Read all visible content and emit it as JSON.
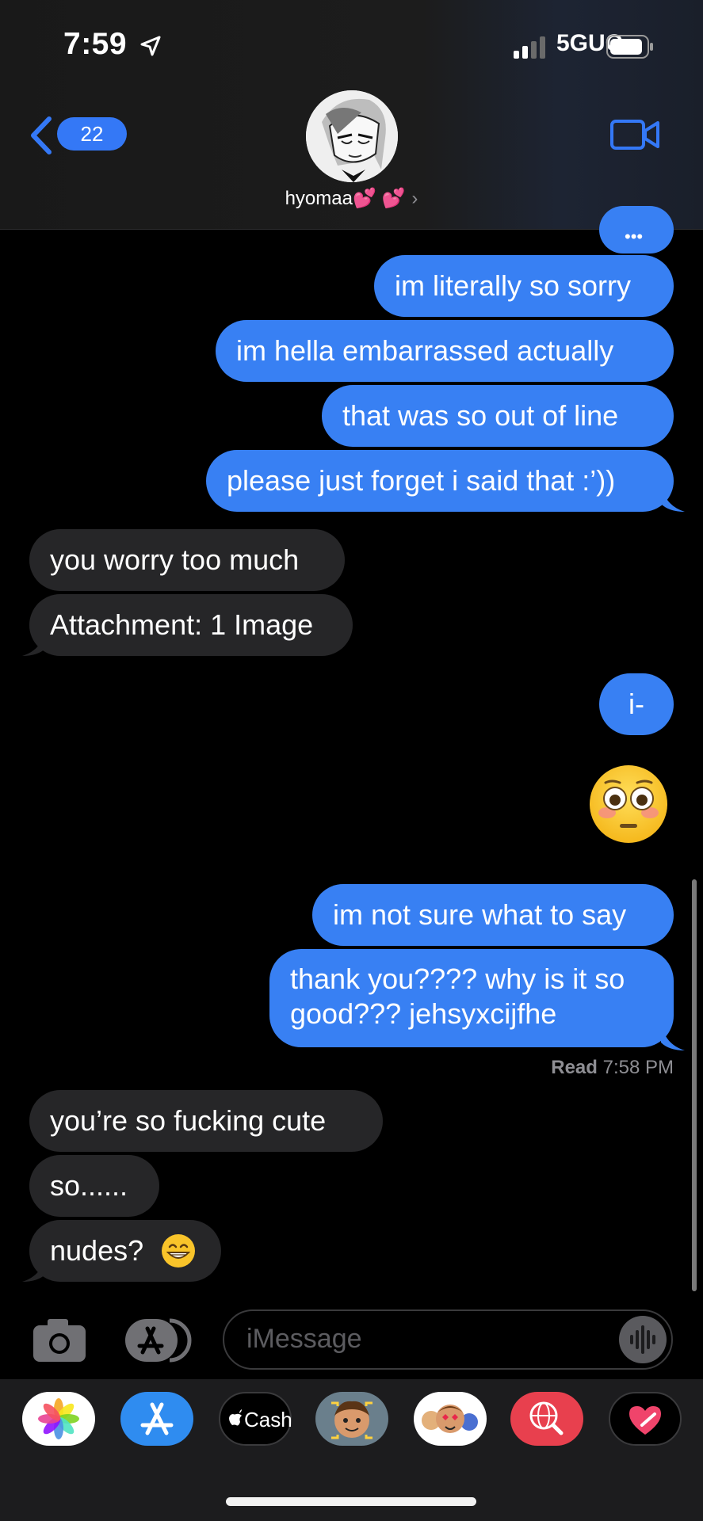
{
  "status_bar": {
    "time": "7:59",
    "network": "5GUC"
  },
  "header": {
    "back_count": "22",
    "contact_name": "hyomaa💕 💕",
    "chevron": "›"
  },
  "messages": [
    {
      "dir": "out",
      "text": "im literally so sorry"
    },
    {
      "dir": "out",
      "text": "im hella embarrassed actually"
    },
    {
      "dir": "out",
      "text": "that was so out of line"
    },
    {
      "dir": "out",
      "text": "please just forget i said that :’))"
    },
    {
      "dir": "in",
      "text": "you worry too much"
    },
    {
      "dir": "in",
      "text": "Attachment: 1 Image"
    },
    {
      "dir": "out",
      "text": "i-"
    },
    {
      "dir": "out",
      "text": "im not sure what to say"
    },
    {
      "dir": "out",
      "line1": "thank you???? why is it so",
      "line2": "good??? jehsyxcijfhe"
    },
    {
      "dir": "in",
      "text": "you’re so fucking cute"
    },
    {
      "dir": "in",
      "text": "so......"
    },
    {
      "dir": "in",
      "text": "nudes?"
    }
  ],
  "read_receipt": {
    "label": "Read",
    "time": "7:58 PM"
  },
  "compose": {
    "placeholder": "iMessage"
  },
  "app_tray": [
    {
      "name": "photos"
    },
    {
      "name": "app-store"
    },
    {
      "name": "apple-cash",
      "label": "Cash"
    },
    {
      "name": "memoji-camera"
    },
    {
      "name": "memoji-stickers"
    },
    {
      "name": "images-search"
    },
    {
      "name": "digital-touch"
    }
  ],
  "colors": {
    "outgoing": "#3880f3",
    "incoming": "#262628",
    "accent": "#3478f6"
  }
}
